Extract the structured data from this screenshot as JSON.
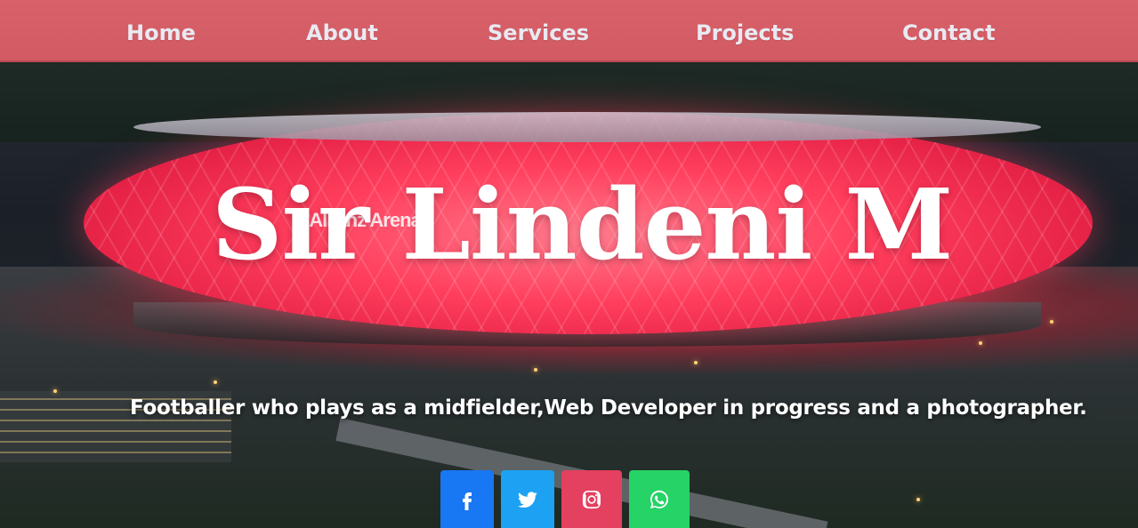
{
  "nav": {
    "items": [
      {
        "label": "Home"
      },
      {
        "label": "About"
      },
      {
        "label": "Services"
      },
      {
        "label": "Projects"
      },
      {
        "label": "Contact"
      }
    ]
  },
  "hero": {
    "title": "Sir Lindeni M",
    "subtitle": "Footballer who plays as a midfielder,Web Developer in progress and a photographer.",
    "stadium_sign": "Allianz Arena"
  },
  "social": [
    {
      "icon": "facebook-icon",
      "color": "#1877f2"
    },
    {
      "icon": "twitter-icon",
      "color": "#1da1f2"
    },
    {
      "icon": "instagram-icon",
      "color": "#e4405f"
    },
    {
      "icon": "whatsapp-icon",
      "color": "#25d366"
    }
  ],
  "colors": {
    "navbar": "#d8616a",
    "nav_text": "#e9e9f1"
  }
}
